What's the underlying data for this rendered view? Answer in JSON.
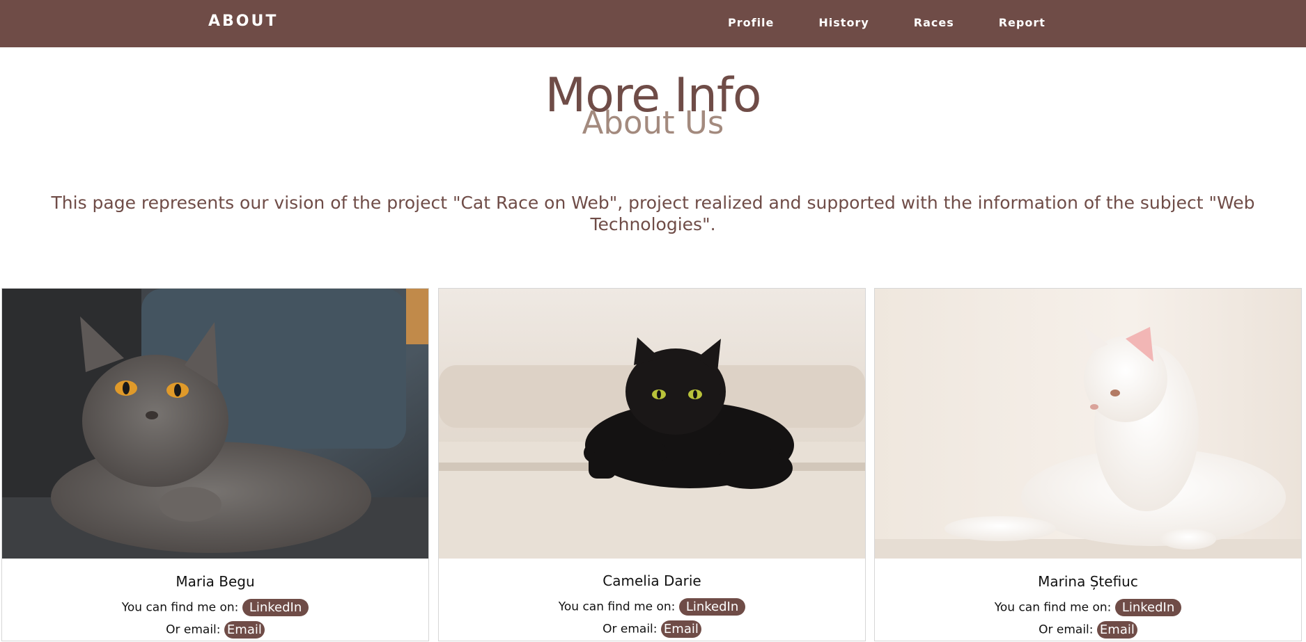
{
  "nav": {
    "brand": "ABOUT",
    "links": [
      "Profile",
      "History",
      "Races",
      "Report"
    ]
  },
  "header": {
    "title": "More Info",
    "subtitle": "About Us"
  },
  "description": "This page represents our vision of the project \"Cat Race on Web\", project realized and supported with the information of the subject \"Web Technologies\".",
  "team": [
    {
      "name": "Maria Begu",
      "find_label": "You can find me on:",
      "linkedin_label": "LinkedIn",
      "email_label": "Or email:",
      "email_button": "Email",
      "photo": "grey-cat-photo"
    },
    {
      "name": "Camelia Darie",
      "find_label": "You can find me on:",
      "linkedin_label": "LinkedIn",
      "email_label": "Or email:",
      "email_button": "Email",
      "photo": "black-cat-photo"
    },
    {
      "name": "Marina Ștefiuc",
      "find_label": "You can find me on:",
      "linkedin_label": "LinkedIn",
      "email_label": "Or email:",
      "email_button": "Email",
      "photo": "white-cat-photo"
    }
  ],
  "colors": {
    "primary": "#6f4c47",
    "secondary": "#a38a7e",
    "background": "#ffffff"
  }
}
